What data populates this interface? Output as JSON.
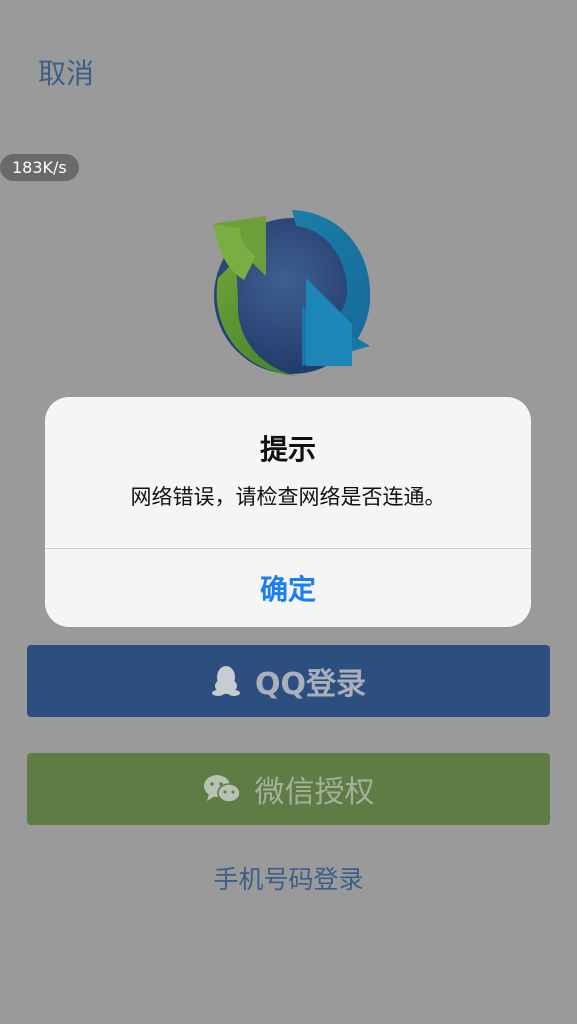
{
  "header": {
    "cancel_label": "取消"
  },
  "status": {
    "network_speed": "183K/s"
  },
  "logo": {
    "icon": "sync-arrows-globe-logo"
  },
  "login": {
    "qq_label": "QQ登录",
    "wechat_label": "微信授权",
    "phone_label": "手机号码登录"
  },
  "alert": {
    "title": "提示",
    "message": "网络错误，请检查网络是否连通。",
    "confirm_label": "确定"
  },
  "colors": {
    "accent": "#1a7ff0",
    "qq_button": "#2d4f80",
    "wechat_button": "#5e7c44"
  }
}
